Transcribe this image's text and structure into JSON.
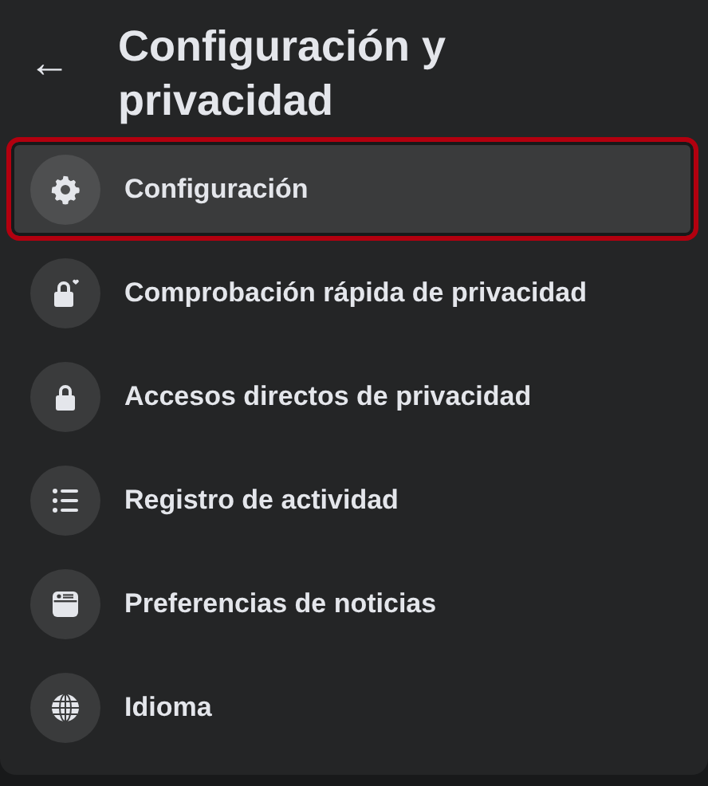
{
  "header": {
    "back": "←",
    "title": "Configuración y privacidad"
  },
  "items": [
    {
      "label": "Configuración",
      "selected": true
    },
    {
      "label": "Comprobación rápida de privacidad",
      "selected": false
    },
    {
      "label": "Accesos directos de privacidad",
      "selected": false
    },
    {
      "label": "Registro de actividad",
      "selected": false
    },
    {
      "label": "Preferencias de noticias",
      "selected": false
    },
    {
      "label": "Idioma",
      "selected": false
    }
  ]
}
